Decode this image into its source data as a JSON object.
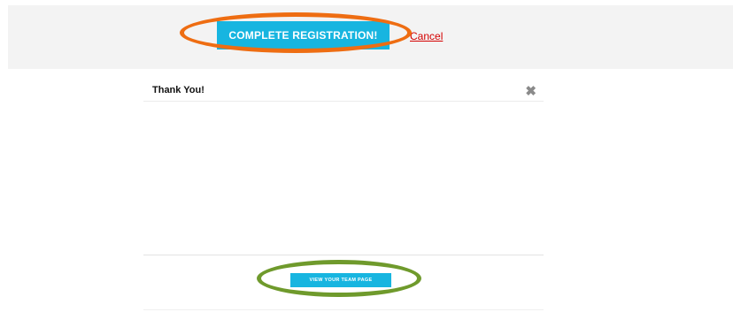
{
  "registration": {
    "complete_label": "COMPLETE REGISTRATION!",
    "cancel_label": "Cancel"
  },
  "modal": {
    "title": "Thank You!",
    "close_glyph": "✖",
    "view_team_label": "VIEW YOUR TEAM PAGE"
  },
  "colors": {
    "button_blue": "#17b5e0",
    "highlight_orange": "#ee6d12",
    "highlight_green": "#6f9a2c",
    "cancel_red": "#d40000"
  }
}
